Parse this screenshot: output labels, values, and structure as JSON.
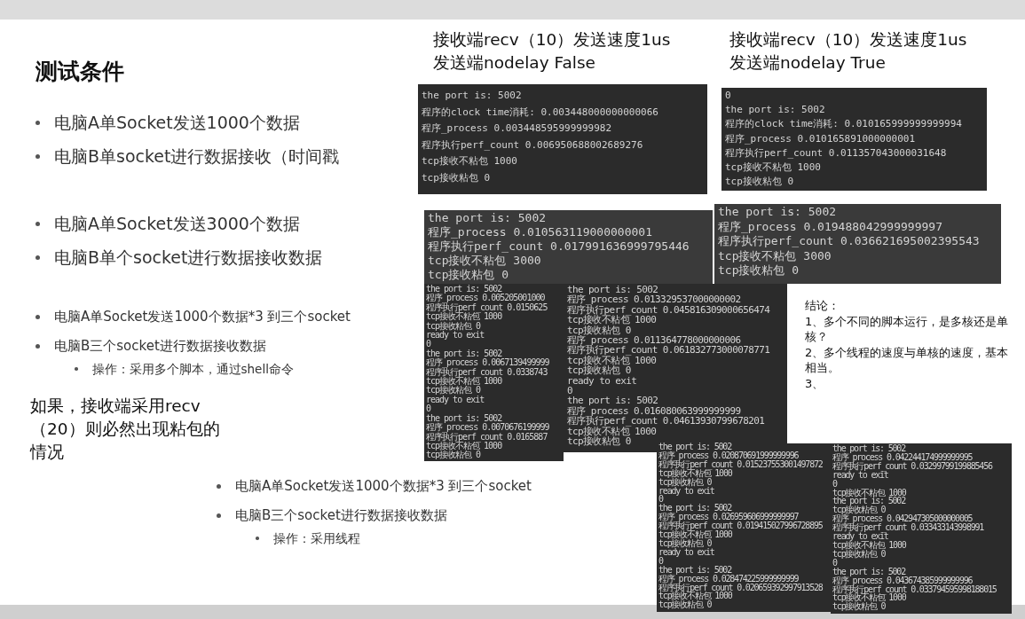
{
  "slide": {
    "title": "测试条件",
    "bullet_groups": [
      {
        "items": [
          {
            "text": "电脑A单Socket发送1000个数据"
          },
          {
            "text": "电脑B单socket进行数据接收（时间戳"
          }
        ]
      },
      {
        "items": [
          {
            "text": "电脑A单Socket发送3000个数据"
          },
          {
            "text": "电脑B单个socket进行数据接收数据"
          }
        ]
      },
      {
        "items": [
          {
            "text": "电脑A单Socket发送1000个数据*3 到三个socket"
          },
          {
            "text": "电脑B三个socket进行数据接收数据",
            "children": [
              {
                "text": "操作：采用多个脚本，通过shell命令"
              }
            ]
          }
        ]
      }
    ],
    "note": "如果，接收端采用recv（20）则必然出现粘包的情况",
    "bottom_bullets": [
      {
        "text": "电脑A单Socket发送1000个数据*3 到三个socket"
      },
      {
        "text": "电脑B三个socket进行数据接收数据",
        "children": [
          {
            "text": "操作：采用线程"
          }
        ]
      }
    ],
    "captions": [
      {
        "lines": [
          "接收端recv（10）发送速度1us",
          "发送端nodelay False"
        ]
      },
      {
        "lines": [
          "接收端recv（10）发送速度1us",
          "发送端nodelay True"
        ]
      }
    ],
    "terminals": [
      {
        "lines": [
          "the port is:  5002",
          "程序的clock time消耗:  0.003448000000000066",
          "程序_process 0.003448595999999982",
          "程序执行perf_count 0.006950688002689276",
          "tcp接收不粘包 1000",
          "tcp接收粘包 0"
        ]
      },
      {
        "lines": [
          "0",
          "the port is:  5002",
          "程序的clock time消耗:  0.010165999999999994",
          "程序_process 0.010165891000000001",
          "程序执行perf_count 0.011357043000031648",
          "tcp接收不粘包 1000",
          "tcp接收粘包 0"
        ]
      },
      {
        "lines": [
          "the port is:  5002",
          "程序_process 0.010563119000000001",
          "程序执行perf_count 0.017991636999795446",
          "tcp接收不粘包 3000",
          "tcp接收粘包 0"
        ]
      },
      {
        "lines": [
          "the port is:  5002",
          "程序_process 0.019488042999999997",
          "程序执行perf_count 0.036621695002395543",
          "tcp接收不粘包 3000",
          "tcp接收粘包 0"
        ]
      },
      {
        "lines": [
          "the port is:  5002",
          "程序_process 0.005205001000",
          "程序执行perf_count 0.0150625",
          "tcp接收不粘包 1000",
          "tcp接收粘包 0",
          "ready to exit",
          "0",
          "the port is:  5002",
          "程序_process 0.0067139499999",
          "程序执行perf_count 0.0338743",
          "tcp接收不粘包 1000",
          "tcp接收粘包 0",
          "ready to exit",
          "0",
          "the port is:  5002",
          "程序_process 0.0070676199999",
          "程序执行perf_count 0.0165887",
          "tcp接收不粘包 1000",
          "tcp接收粘包 0"
        ]
      },
      {
        "lines": [
          "the port is:  5002",
          "程序_process 0.013329537000000002",
          "程序执行perf_count 0.045816309000656474",
          "tcp接收不粘包 1000",
          "tcp接收粘包 0",
          "程序_process 0.011364778000000006",
          "程序执行perf_count 0.061832773000078771",
          "tcp接收不粘包 1000",
          "tcp接收粘包 0",
          "ready to exit",
          "0",
          "the port is:  5002",
          "程序_process 0.016080063999999999",
          "程序执行perf_count 0.04613930799678201",
          "tcp接收不粘包 1000",
          "tcp接收粘包 0"
        ]
      },
      {
        "lines": [
          "the port is:  5002",
          "程序_process 0.020870691999999996",
          "程序执行perf_count 0.015237553001497872",
          "tcp接收不粘包 1000",
          "tcp接收粘包 0",
          "ready to exit",
          "0",
          "the port is:  5002",
          "程序_process 0.026959606999999997",
          "程序执行perf_count 0.019415027996728895",
          "tcp接收不粘包 1000",
          "tcp接收粘包 0",
          "ready to exit",
          "0",
          "the port is:  5002",
          "程序_process 0.028474225999999999",
          "程序执行perf_count 0.020659392997913528",
          "tcp接收不粘包 1000",
          "tcp接收粘包 0"
        ]
      },
      {
        "lines": [
          "the port is:  5002",
          "程序_process 0.042244174999999995",
          "程序执行perf_count 0.03299799199885456",
          "ready to exit",
          "0",
          "tcp接收不粘包 1000",
          "the port is:  5002",
          "tcp接收粘包 0",
          "程序_process 0.042947305000000005",
          "程序执行perf_count 0.033433143998991",
          "ready to exit",
          "tcp接收不粘包 1000",
          "tcp接收粘包 0",
          "0",
          "the port is:  5002",
          "程序_process 0.043674385999999996",
          "程序执行perf_count 0.033794595998188015",
          "tcp接收不粘包 1000",
          "tcp接收粘包 0"
        ]
      }
    ],
    "conclusion": {
      "lines": [
        "结论：",
        "1、多个不同的脚本运行，是多核还是单核？",
        "2、多个线程的速度与单核的速度，基本相当。",
        "3、"
      ]
    }
  }
}
